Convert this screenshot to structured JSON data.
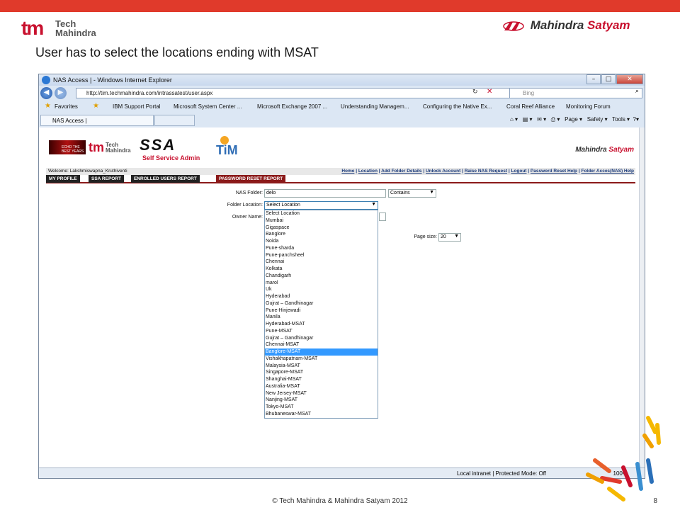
{
  "slide": {
    "headline": "User has to select the locations ending with MSAT",
    "tm_logo_text": "Tech\nMahindra",
    "ms_logo_main": "Mahindra ",
    "ms_logo_accent": "Satyam",
    "footer": "© Tech Mahindra & Mahindra Satyam 2012",
    "page_number": "8",
    "accent_color": "#e03a2b"
  },
  "browser": {
    "window_title": "NAS Access | - Windows Internet Explorer",
    "url": "http://tim.techmahindra.com/intrassatest/user.aspx",
    "search_placeholder": "Bing",
    "favorites_label": "Favorites",
    "favorites": [
      "IBM Support Portal",
      "Microsoft System Center ...",
      "Microsoft Exchange 2007 ...",
      "Understanding Managem...",
      "Configuring the Native Ex...",
      "Coral Reef Alliance",
      "Monitoring Forum"
    ],
    "tab_title": "NAS Access |",
    "cmd_page": "Page ▾",
    "cmd_safety": "Safety ▾",
    "cmd_tools": "Tools ▾",
    "status_zone": "Local intranet | Protected Mode: Off",
    "zoom": "100%"
  },
  "site": {
    "banner_text": "ECHO THE BEST YEARS",
    "ssa_title": "SSA",
    "ssa_subtitle": "Self Service Admin",
    "tim_letters": "TiM",
    "welcome": "Welcome: Lakshmiswapna_Kruthiventi",
    "top_links": [
      "Home",
      "Location",
      "Add Folder Details",
      "Unlock Account",
      "Raise NAS Request",
      "Logout",
      "Password Reset Help",
      "Folder Acces(NAS) Help"
    ],
    "nav_tabs": [
      "MY PROFILE",
      "SSA REPORT",
      "ENROLLED USERS REPORT",
      "PASSWORD RESET REPORT"
    ]
  },
  "form": {
    "nas_folder_label": "NAS Folder:",
    "nas_folder_value": "delo",
    "match_mode": "Contains",
    "folder_location_label": "Folder Location:",
    "folder_location_value": "Select Location",
    "owner_name_label": "Owner Name:",
    "page_size_label": "Page size:",
    "page_size_value": "20",
    "highlighted_location": "Banglore-MSAT",
    "locations": [
      "Select Location",
      "Mumbai",
      "Gigaspace",
      "Banglore",
      "Noida",
      "Pune-sharda",
      "Pune-panchsheel",
      "Chennai",
      "Kolkata",
      "Chandigarh",
      "marol",
      "Uk",
      "Hyderabad",
      "Gujrat – Gandhinagar",
      "Pune-Hinjewadi",
      "Manila",
      "Hyderabad-MSAT",
      "Pune-MSAT",
      "Gujrat – Gandhinagar",
      "Chennai-MSAT",
      "Banglore-MSAT",
      "Vishakhapatnam-MSAT",
      "Malaysia-MSAT",
      "Singapore-MSAT",
      "Shanghai-MSAT",
      "Australia-MSAT",
      "New Jersey-MSAT",
      "Nanjing-MSAT",
      "Tokyo-MSAT",
      "Bhubaneswar-MSAT"
    ]
  }
}
